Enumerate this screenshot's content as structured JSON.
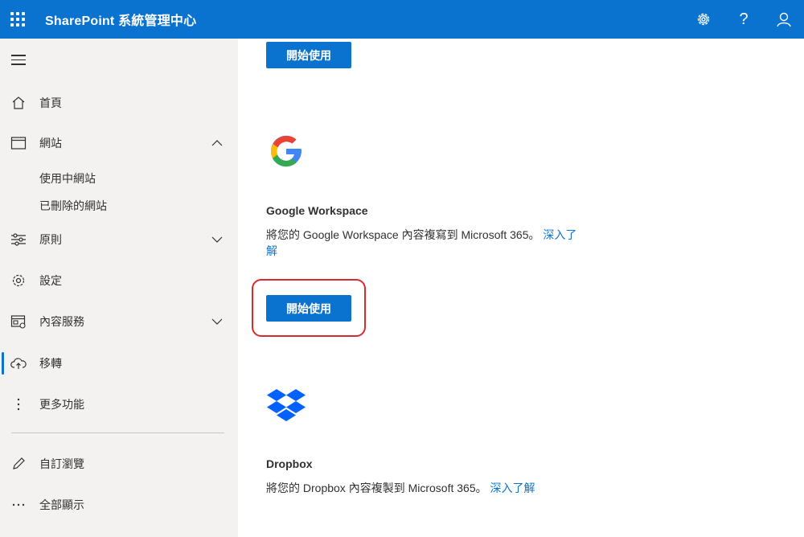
{
  "header": {
    "title": "SharePoint 系統管理中心",
    "icons": [
      "waffle-icon",
      "settings-icon",
      "help-icon",
      "account-icon"
    ]
  },
  "sidebar": {
    "items": [
      {
        "label": "首頁",
        "icon": "home-icon"
      },
      {
        "label": "網站",
        "icon": "sites-icon",
        "expanded": true,
        "children": [
          "使用中網站",
          "已刪除的網站"
        ]
      },
      {
        "label": "原則",
        "icon": "policies-icon",
        "expanded": false
      },
      {
        "label": "設定",
        "icon": "settings-icon"
      },
      {
        "label": "內容服務",
        "icon": "content-services-icon",
        "expanded": false
      },
      {
        "label": "移轉",
        "icon": "migration-icon",
        "active": true
      },
      {
        "label": "更多功能",
        "icon": "more-features-icon"
      },
      {
        "label": "自訂瀏覽",
        "icon": "edit-icon"
      },
      {
        "label": "全部顯示",
        "icon": "ellipsis-icon"
      }
    ]
  },
  "main": {
    "top_button": "開始使用",
    "cards": [
      {
        "title": "Google Workspace",
        "desc": "將您的 Google Workspace 內容複寫到 Microsoft 365。",
        "link": "深入了解",
        "button": "開始使用",
        "logo": "google-logo"
      },
      {
        "title": "Dropbox",
        "desc": "將您的 Dropbox 內容複製到 Microsoft 365。",
        "link": "深入了解",
        "logo": "dropbox-logo"
      }
    ]
  },
  "colors": {
    "accent": "#0a73d0",
    "highlight": "#d92b2b",
    "sidebar_bg": "#f3f2f1"
  }
}
